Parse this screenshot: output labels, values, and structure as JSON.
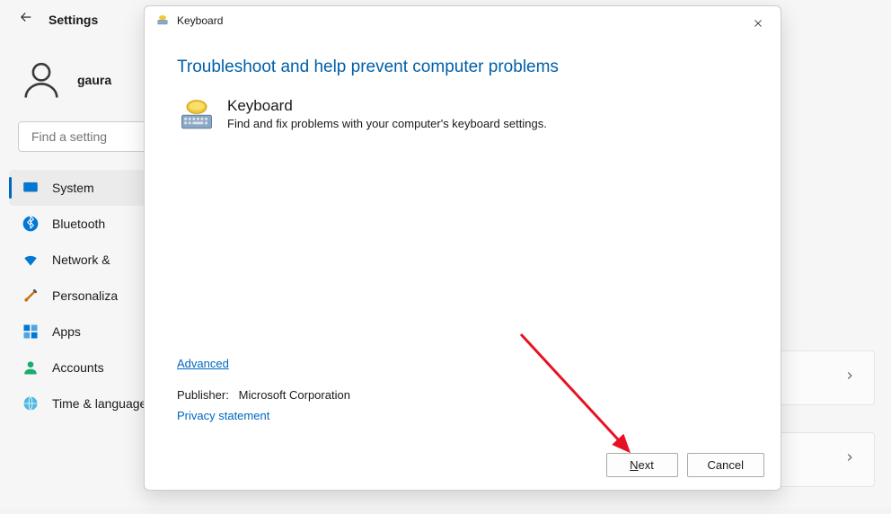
{
  "settings": {
    "title": "Settings",
    "user_name": "gaura",
    "search_placeholder": "Find a setting",
    "sidebar": [
      {
        "label": "System",
        "active": true
      },
      {
        "label": "Bluetooth"
      },
      {
        "label": "Network &"
      },
      {
        "label": "Personaliza"
      },
      {
        "label": "Apps"
      },
      {
        "label": "Accounts"
      },
      {
        "label": "Time & language"
      }
    ]
  },
  "dialog": {
    "title": "Keyboard",
    "heading": "Troubleshoot and help prevent computer problems",
    "section_title": "Keyboard",
    "section_desc": "Find and fix problems with your computer's keyboard settings.",
    "advanced": "Advanced",
    "publisher_label": "Publisher:",
    "publisher_value": "Microsoft Corporation",
    "privacy": "Privacy statement",
    "next": "Next",
    "cancel": "Cancel"
  }
}
